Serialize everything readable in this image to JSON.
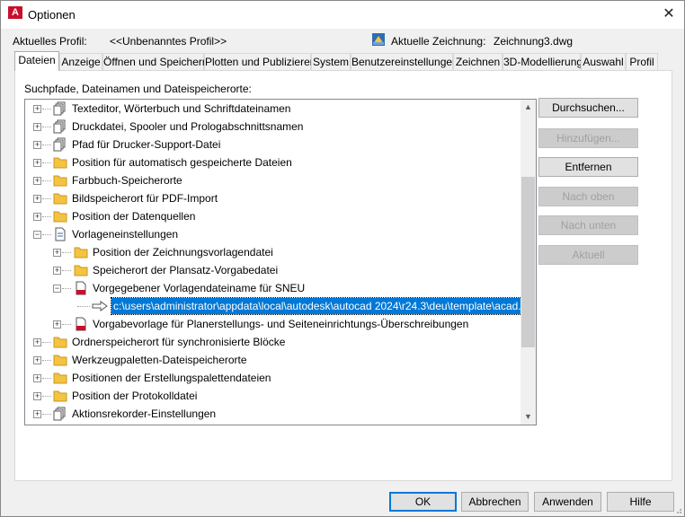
{
  "window": {
    "title": "Optionen",
    "close_glyph": "✕"
  },
  "profile": {
    "label": "Aktuelles Profil:",
    "value": "<<Unbenanntes Profil>>"
  },
  "drawing": {
    "label": "Aktuelle Zeichnung:",
    "value": "Zeichnung3.dwg",
    "icon": "drawing-icon"
  },
  "tabs": [
    {
      "label": "Dateien",
      "active": true
    },
    {
      "label": "Anzeige"
    },
    {
      "label": "Öffnen und Speichern"
    },
    {
      "label": "Plotten und Publizieren"
    },
    {
      "label": "System"
    },
    {
      "label": "Benutzereinstellungen"
    },
    {
      "label": "Zeichnen"
    },
    {
      "label": "3D-Modellierung"
    },
    {
      "label": "Auswahl"
    },
    {
      "label": "Profil"
    }
  ],
  "panel": {
    "label": "Suchpfade, Dateinamen und Dateispeicherorte:"
  },
  "tree": {
    "items": [
      {
        "label": "Texteditor, Wörterbuch und Schriftdateinamen",
        "icon": "files-icon"
      },
      {
        "label": "Druckdatei, Spooler und Prologabschnittsnamen",
        "icon": "files-icon"
      },
      {
        "label": "Pfad für Drucker-Support-Datei",
        "icon": "files-icon"
      },
      {
        "label": "Position für automatisch gespeicherte Dateien",
        "icon": "folder-icon"
      },
      {
        "label": "Farbbuch-Speicherorte",
        "icon": "folder-icon"
      },
      {
        "label": "Bildspeicherort für PDF-Import",
        "icon": "folder-icon"
      },
      {
        "label": "Position der Datenquellen",
        "icon": "folder-icon"
      },
      {
        "label": "Vorlageneinstellungen",
        "icon": "template-icon"
      },
      {
        "label": "Position der Zeichnungsvorlagendatei",
        "icon": "folder-icon"
      },
      {
        "label": "Speicherort der Plansatz-Vorgabedatei",
        "icon": "folder-icon"
      },
      {
        "label": "Vorgegebener Vorlagendateiname für SNEU",
        "icon": "dwt-icon"
      },
      {
        "label": "c:\\users\\administrator\\appdata\\local\\autodesk\\autocad 2024\\r24.3\\deu\\template\\acad.dwt",
        "icon": "arrow-icon"
      },
      {
        "label": "Vorgabevorlage für Planerstellungs- und Seiteneinrichtungs-Überschreibungen",
        "icon": "dwt-icon"
      },
      {
        "label": "Ordnerspeicherort für synchronisierte Blöcke",
        "icon": "folder-icon"
      },
      {
        "label": "Werkzeugpaletten-Dateispeicherorte",
        "icon": "folder-icon"
      },
      {
        "label": "Positionen der Erstellungspalettendateien",
        "icon": "folder-icon"
      },
      {
        "label": "Position der Protokolldatei",
        "icon": "folder-icon"
      },
      {
        "label": "Aktionsrekorder-Einstellungen",
        "icon": "files-icon"
      }
    ]
  },
  "side_buttons": [
    {
      "label": "Durchsuchen...",
      "enabled": true
    },
    {
      "label": "Hinzufügen...",
      "enabled": false
    },
    {
      "label": "Entfernen",
      "enabled": true
    },
    {
      "label": "Nach oben",
      "enabled": false
    },
    {
      "label": "Nach unten",
      "enabled": false
    },
    {
      "label": "Aktuell",
      "enabled": false
    }
  ],
  "footer": {
    "ok": "OK",
    "cancel": "Abbrechen",
    "apply": "Anwenden",
    "help": "Hilfe"
  },
  "colors": {
    "selection": "#0078d7",
    "folder": "#f5c342",
    "dwt_red": "#c8102e"
  }
}
